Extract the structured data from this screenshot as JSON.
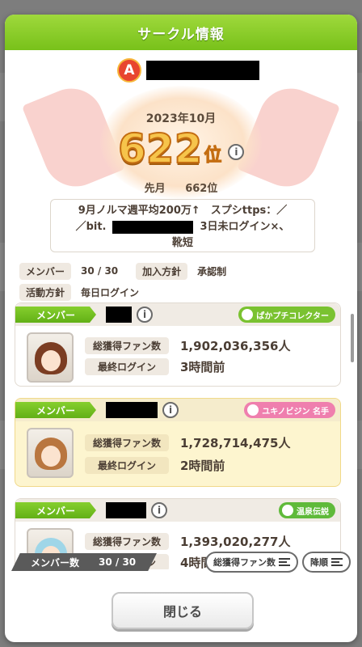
{
  "dialog": {
    "title": "サークル情報"
  },
  "circle": {
    "rank_badge": "A",
    "month": "2023年10月",
    "rank": "622",
    "rank_unit": "位",
    "last_month_label": "先月",
    "last_month_rank": "662位",
    "description": {
      "line1": "9月ノルマ週平均200万↑　スプシttps：／",
      "line2_prefix": "／bit.",
      "line2_suffix": "3日未ログイン×、",
      "line3": "靴短"
    },
    "info": {
      "member_label": "メンバー",
      "member_value": "30 / 30",
      "join_label": "加入方針",
      "join_value": "承認制",
      "activity_label": "活動方針",
      "activity_value": "毎日ログイン"
    }
  },
  "members": [
    {
      "role": "メンバー",
      "title_badge": "ぱかプチコレクター",
      "title_color": "#7ac230",
      "fans_label": "総獲得ファン数",
      "fans": "1,902,036,356人",
      "login_label": "最終ログイン",
      "login": "3時間前",
      "hair_color": "#7b3d22"
    },
    {
      "role": "メンバー",
      "title_badge": "ユキノビジン 名手",
      "title_color": "#ef7fae",
      "fans_label": "総獲得ファン数",
      "fans": "1,728,714,475人",
      "login_label": "最終ログイン",
      "login": "2時間前",
      "hair_color": "#b9763f"
    },
    {
      "role": "メンバー",
      "title_badge": "温泉伝説",
      "title_color": "#5fba3a",
      "fans_label": "総獲得ファン数",
      "fans": "1,393,020,277人",
      "login_label": "最終ログイン",
      "login": "4時間前",
      "hair_color": "#9fd6e8"
    }
  ],
  "footer": {
    "member_count_label": "メンバー数",
    "member_count_value": "30 / 30",
    "sort_label": "総獲得ファン数",
    "order_label": "降順",
    "close_label": "閉じる"
  }
}
